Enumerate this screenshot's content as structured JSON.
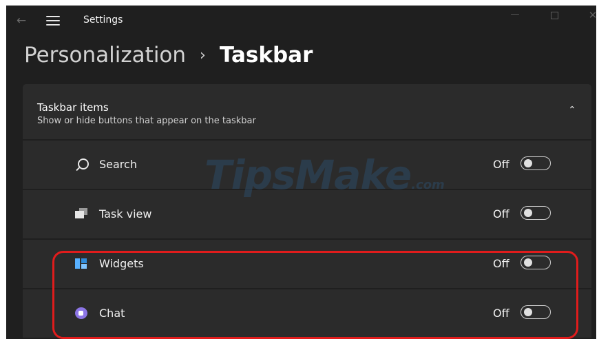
{
  "window": {
    "back_glyph": "←",
    "title": "Settings",
    "minimize_glyph": "—",
    "close_glyph": "✕"
  },
  "breadcrumb": {
    "parent": "Personalization",
    "separator": "›",
    "current": "Taskbar"
  },
  "section": {
    "title": "Taskbar items",
    "subtitle": "Show or hide buttons that appear on the taskbar",
    "collapse_glyph": "⌃"
  },
  "items": [
    {
      "label": "Search",
      "state": "Off",
      "icon": "search-icon",
      "on": false
    },
    {
      "label": "Task view",
      "state": "Off",
      "icon": "task-view-icon",
      "on": false
    },
    {
      "label": "Widgets",
      "state": "Off",
      "icon": "widgets-icon",
      "on": false
    },
    {
      "label": "Chat",
      "state": "Off",
      "icon": "chat-icon",
      "on": false
    }
  ],
  "watermark": {
    "main": "TipsMake",
    "suffix": ".com"
  },
  "colors": {
    "window_bg": "#1f1f1f",
    "card_bg": "#2b2b2b",
    "highlight": "#e01c1c",
    "widgets_accent": "#58b0ff",
    "chat_accent": "#8c75e6"
  }
}
